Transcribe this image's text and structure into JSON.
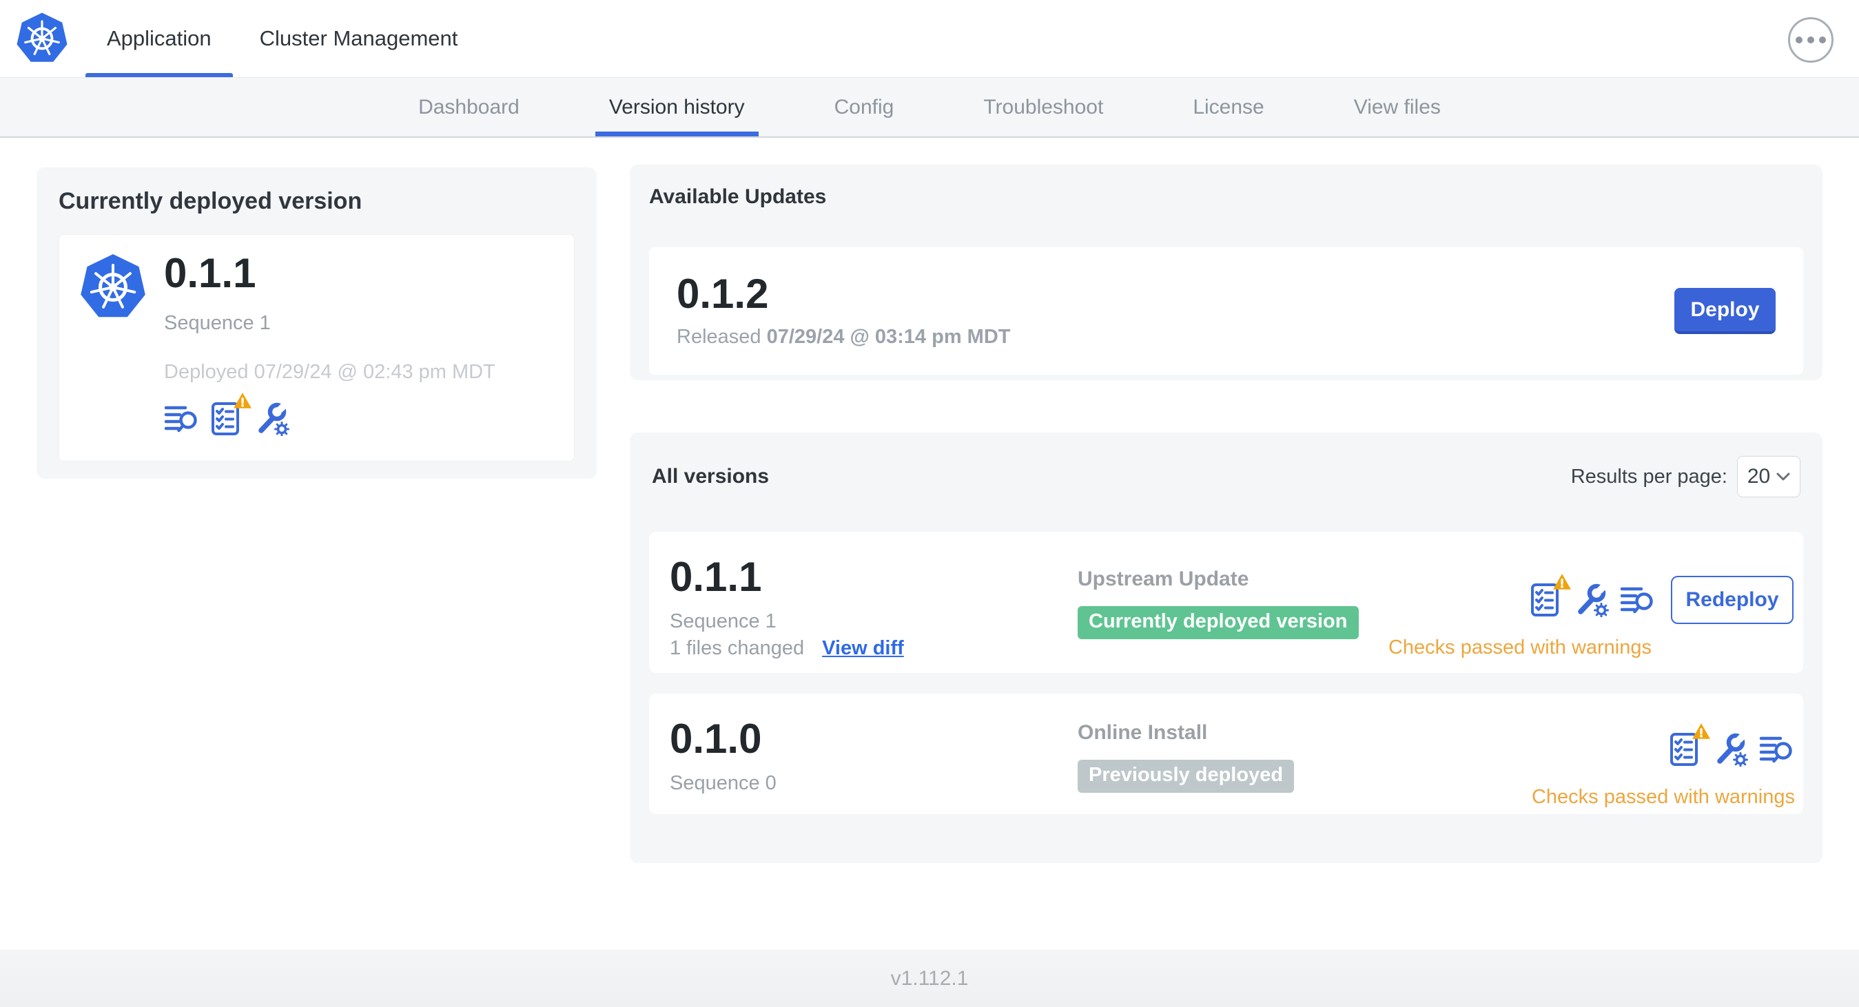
{
  "colors": {
    "accent_blue": "#3a6ada",
    "brand_blue": "#326ce5",
    "badge_green": "#5fc492",
    "badge_gray": "#bec7ca",
    "warning_orange": "#eda63d"
  },
  "topnav": {
    "logo_icon": "kubernetes-logo",
    "menu_icon": "ellipsis-icon",
    "tabs": [
      {
        "label": "Application",
        "active": true
      },
      {
        "label": "Cluster Management",
        "active": false
      }
    ]
  },
  "subnav": {
    "tabs": [
      {
        "label": "Dashboard",
        "active": false
      },
      {
        "label": "Version history",
        "active": true
      },
      {
        "label": "Config",
        "active": false
      },
      {
        "label": "Troubleshoot",
        "active": false
      },
      {
        "label": "License",
        "active": false
      },
      {
        "label": "View files",
        "active": false
      }
    ]
  },
  "current_version_card": {
    "title": "Currently deployed version",
    "version": "0.1.1",
    "sequence": "Sequence 1",
    "deployed": "Deployed 07/29/24 @ 02:43 pm MDT",
    "icons": [
      "logs-icon",
      "preflight-checks-warning-icon",
      "config-icon"
    ]
  },
  "available_updates_card": {
    "title": "Available Updates",
    "version": "0.1.2",
    "released_prefix": "Released ",
    "released_date": "07/29/24 @ 03:14 pm MDT",
    "deploy_button": "Deploy"
  },
  "all_versions_card": {
    "title": "All versions",
    "results_per_page_label": "Results per page:",
    "results_per_page_value": "20",
    "rows": [
      {
        "version": "0.1.1",
        "sequence": "Sequence 1",
        "files_changed": "1 files changed",
        "view_diff_label": "View diff",
        "source": "Upstream Update",
        "badge": "Currently deployed version",
        "badge_style": "green",
        "icons": [
          "preflight-checks-warning-icon",
          "config-icon",
          "logs-icon"
        ],
        "action_button": "Redeploy",
        "status": "Checks passed with warnings"
      },
      {
        "version": "0.1.0",
        "sequence": "Sequence 0",
        "source": "Online Install",
        "badge": "Previously deployed",
        "badge_style": "gray",
        "icons": [
          "preflight-checks-warning-icon",
          "config-icon",
          "logs-icon"
        ],
        "status": "Checks passed with warnings"
      }
    ]
  },
  "footer": {
    "version_label": "v1.112.1"
  }
}
